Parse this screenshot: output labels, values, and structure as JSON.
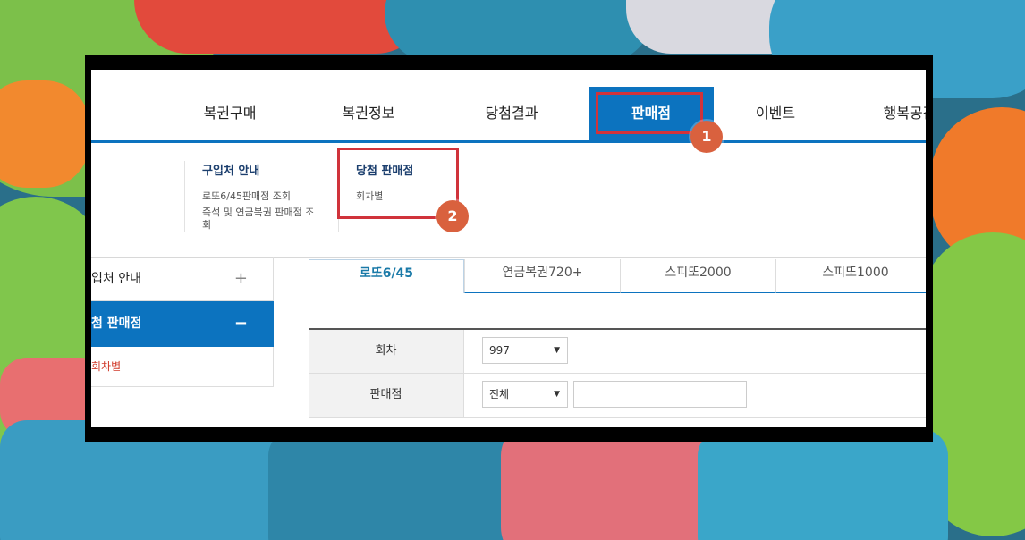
{
  "top_nav": {
    "items": [
      "복권구매",
      "복권정보",
      "당첨결과",
      "판매점",
      "이벤트",
      "행복공감"
    ],
    "active_index": 3
  },
  "dropdown": {
    "col1": {
      "title": "구입처 안내",
      "links": [
        "로또6/45판매점 조회",
        "즉석 및 연금복권 판매점 조회"
      ]
    },
    "col2": {
      "title": "당첨 판매점",
      "links": [
        "회차별"
      ]
    }
  },
  "sidebar": {
    "items": [
      {
        "label": "입처 안내",
        "sign": "+"
      },
      {
        "label": "첨 판매점",
        "sign": "−"
      }
    ],
    "sub_item": "회차별"
  },
  "tabs": [
    "로또6/45",
    "연금복권720+",
    "스피또2000",
    "스피또1000"
  ],
  "form": {
    "round_label": "회차",
    "round_value": "997",
    "store_label": "판매점",
    "store_value": "전체",
    "store_search_value": ""
  },
  "annotations": {
    "badge1": "1",
    "badge2": "2"
  },
  "colors": {
    "accent": "#0c73bf",
    "highlight": "#d0333b",
    "badge": "#d9613e"
  }
}
